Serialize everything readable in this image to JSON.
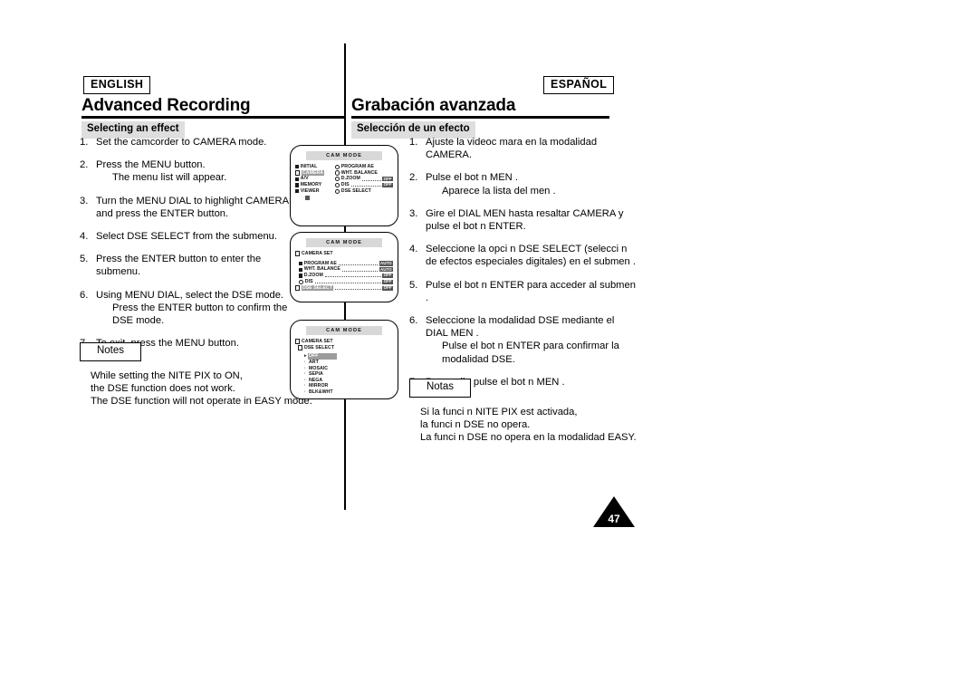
{
  "page": {
    "number": "47"
  },
  "english": {
    "badge": "ENGLISH",
    "title": "Advanced Recording",
    "subhead": "Selecting an effect",
    "steps": [
      {
        "num": "1.",
        "text": "Set the camcorder to CAMERA mode.",
        "sub": ""
      },
      {
        "num": "2.",
        "text": "Press the MENU button.",
        "sub": "The menu list will appear."
      },
      {
        "num": "3.",
        "text": "Turn the MENU DIAL to highlight CAMERA and press the ENTER button.",
        "sub": ""
      },
      {
        "num": "4.",
        "text": "Select DSE SELECT from the submenu.",
        "sub": ""
      },
      {
        "num": "5.",
        "text": "Press the ENTER button to enter the submenu.",
        "sub": ""
      },
      {
        "num": "6.",
        "text": "Using MENU DIAL, select the DSE mode.",
        "sub": "Press the ENTER button to confirm the DSE mode."
      },
      {
        "num": "7.",
        "text": "To exit, press the MENU button.",
        "sub": ""
      }
    ],
    "notes": {
      "label": "Notes",
      "lines": [
        "While setting the NITE PIX to ON,",
        "the DSE function does not work.",
        "The DSE function will not operate in EASY mode."
      ]
    }
  },
  "spanish": {
    "badge": "ESPAÑOL",
    "title": "Grabación avanzada",
    "subhead": "Selección de un efecto",
    "steps": [
      {
        "num": "1.",
        "text": "Ajuste la videoc mara en la modalidad CAMERA.",
        "sub": ""
      },
      {
        "num": "2.",
        "text": "Pulse el bot n MEN .",
        "sub": "Aparece la lista del men ."
      },
      {
        "num": "3.",
        "text": "Gire el DIAL MEN  hasta resaltar CAMERA y pulse el bot n ENTER.",
        "sub": ""
      },
      {
        "num": "4.",
        "text": "Seleccione la opci n DSE SELECT (selecci n de efectos especiales digitales) en el submen .",
        "sub": ""
      },
      {
        "num": "5.",
        "text": "Pulse el bot n ENTER para acceder al submen .",
        "sub": ""
      },
      {
        "num": "6.",
        "text": "Seleccione la modalidad DSE mediante el DIAL MEN .",
        "sub": "Pulse el bot n ENTER para confirmar la modalidad DSE."
      },
      {
        "num": "7.",
        "text": "Para salir, pulse el bot n MEN .",
        "sub": ""
      }
    ],
    "notes": {
      "label": "Notas",
      "lines": [
        "Si la funci n NITE PIX est  activada,",
        "la funci n DSE no opera.",
        "La funci n DSE no opera en la modalidad EASY."
      ]
    }
  },
  "screens": {
    "screen1": {
      "title": "CAM MODE",
      "left_items": [
        {
          "label": "INITIAL",
          "highlighted": false
        },
        {
          "label": "CAMERA",
          "highlighted": true
        },
        {
          "label": "A/V",
          "highlighted": false
        },
        {
          "label": "MEMORY",
          "highlighted": false
        },
        {
          "label": "VIEWER",
          "highlighted": false
        }
      ],
      "right_items": [
        {
          "label": "PROGRAM AE",
          "dots": false,
          "value": ""
        },
        {
          "label": "WHT. BALANCE",
          "dots": false,
          "value": ""
        },
        {
          "label": "D.ZOOM",
          "dots": true,
          "value": "OFF"
        },
        {
          "label": "DIS",
          "dots": true,
          "value": "OFF"
        },
        {
          "label": "DSE SELECT",
          "dots": false,
          "value": ""
        }
      ]
    },
    "screen2": {
      "title": "CAM MODE",
      "header": "CAMERA SET",
      "items": [
        {
          "label": "PROGRAM AE",
          "value": "AUTO",
          "highlighted": false
        },
        {
          "label": "WHT. BALANCE",
          "value": "AUTO",
          "highlighted": false
        },
        {
          "label": "D.ZOOM",
          "value": "OFF",
          "highlighted": false
        },
        {
          "label": "DIS",
          "value": "OFF",
          "highlighted": false
        },
        {
          "label": "DSE SELECT",
          "value": "OFF",
          "highlighted": true
        }
      ]
    },
    "screen3": {
      "title": "CAM MODE",
      "header": "CAMERA SET",
      "subheader": "DSE SELECT",
      "options": [
        {
          "label": "OFF",
          "selected": true
        },
        {
          "label": "ART",
          "selected": false
        },
        {
          "label": "MOSAIC",
          "selected": false
        },
        {
          "label": "SEPIA",
          "selected": false
        },
        {
          "label": "NEGA",
          "selected": false
        },
        {
          "label": "MIRROR",
          "selected": false
        },
        {
          "label": "BLK&WHT",
          "selected": false
        }
      ]
    }
  }
}
